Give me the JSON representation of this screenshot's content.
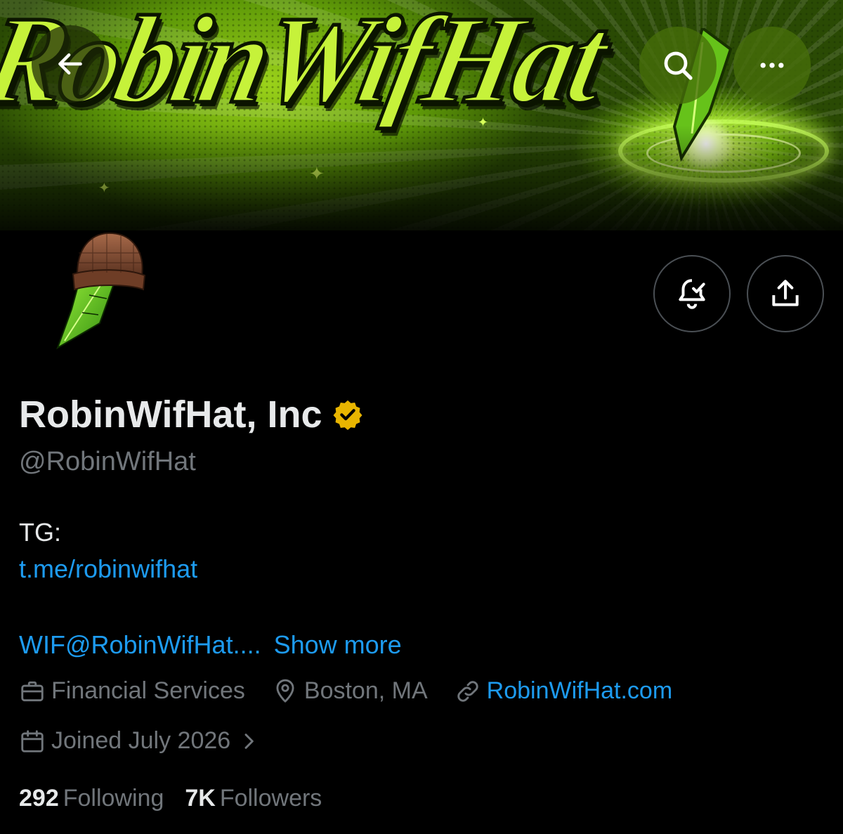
{
  "banner": {
    "title": "RobinWifHat"
  },
  "profile": {
    "display_name": "RobinWifHat, Inc",
    "handle": "@RobinWifHat",
    "verified_color": "#e8b500"
  },
  "bio": {
    "tg_label": "TG:",
    "tg_link": "t.me/robinwifhat",
    "email_truncated": "WIF@RobinWifHat....",
    "show_more": "Show more"
  },
  "meta": {
    "category": "Financial Services",
    "location": "Boston, MA",
    "website": "RobinWifHat.com",
    "joined": "Joined July 2026"
  },
  "stats": {
    "following_count": "292",
    "following_label": "Following",
    "followers_count": "7K",
    "followers_label": "Followers"
  },
  "icons": {
    "back": "arrow-left-icon",
    "search": "search-icon",
    "more": "more-icon",
    "notify": "bell-check-icon",
    "share": "share-icon",
    "verified": "verified-badge-icon",
    "category": "briefcase-icon",
    "location": "location-pin-icon",
    "website": "link-icon",
    "joined": "calendar-icon",
    "joined_chevron": "chevron-right-icon"
  },
  "colors": {
    "background": "#000000",
    "text": "#e7e9ea",
    "secondary": "#71767b",
    "link": "#1d9bf0",
    "banner_green": "#c6f23a"
  }
}
